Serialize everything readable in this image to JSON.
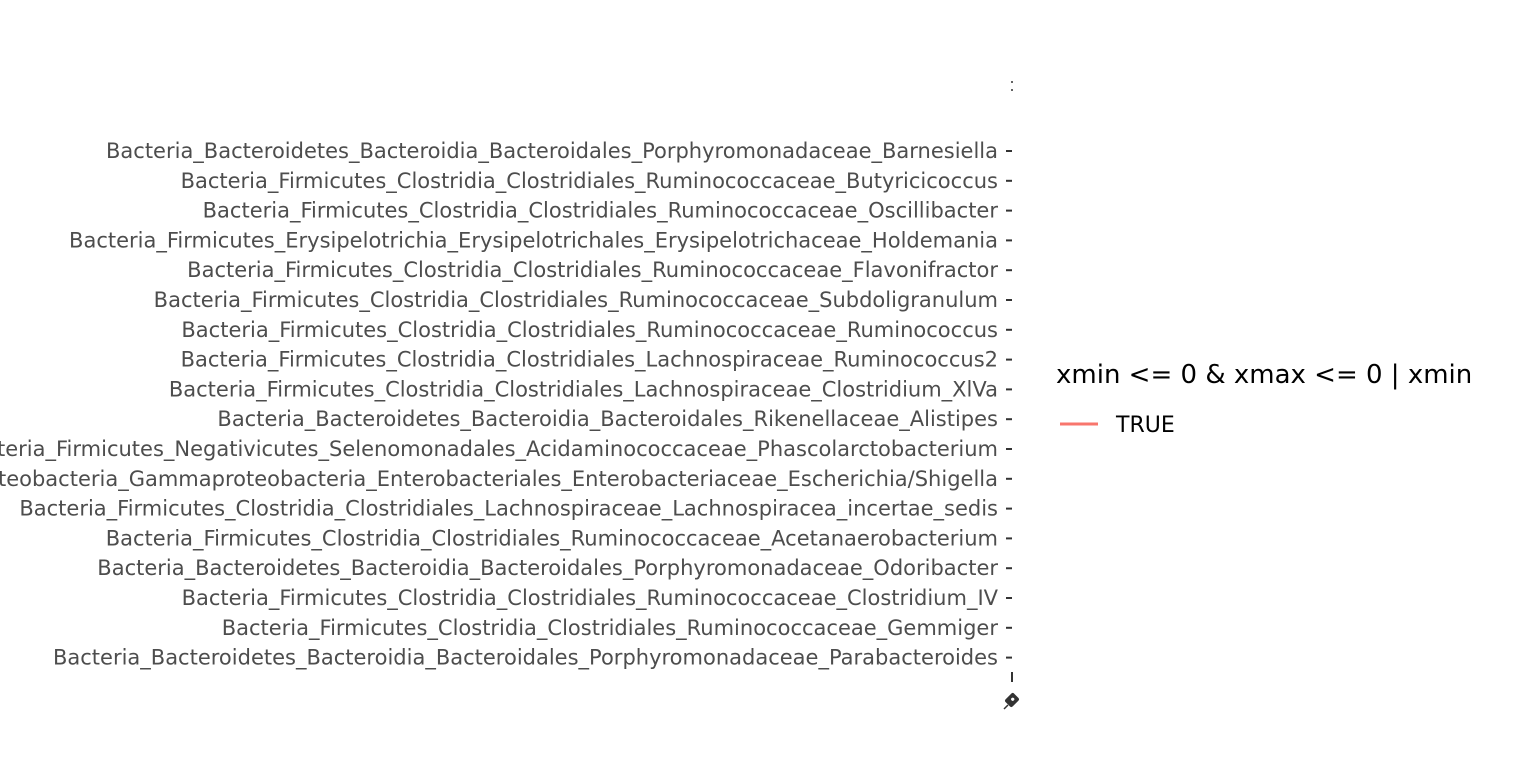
{
  "chart_data": {
    "type": "line",
    "title": "",
    "xlabel": "",
    "ylabel": "",
    "grid": false,
    "legend_position": "right",
    "categories": [
      "Bacteria_Bacteroidetes_Bacteroidia_Bacteroidales_Porphyromonadaceae_Barnesiella",
      "Bacteria_Firmicutes_Clostridia_Clostridiales_Ruminococcaceae_Butyricicoccus",
      "Bacteria_Firmicutes_Clostridia_Clostridiales_Ruminococcaceae_Oscillibacter",
      "Bacteria_Firmicutes_Erysipelotrichia_Erysipelotrichales_Erysipelotrichaceae_Holdemania",
      "Bacteria_Firmicutes_Clostridia_Clostridiales_Ruminococcaceae_Flavonifractor",
      "Bacteria_Firmicutes_Clostridia_Clostridiales_Ruminococcaceae_Subdoligranulum",
      "Bacteria_Firmicutes_Clostridia_Clostridiales_Ruminococcaceae_Ruminococcus",
      "Bacteria_Firmicutes_Clostridia_Clostridiales_Lachnospiraceae_Ruminococcus2",
      "Bacteria_Firmicutes_Clostridia_Clostridiales_Lachnospiraceae_Clostridium_XlVa",
      "Bacteria_Bacteroidetes_Bacteroidia_Bacteroidales_Rikenellaceae_Alistipes",
      "Bacteria_Firmicutes_Negativicutes_Selenomonadales_Acidaminococcaceae_Phascolarctobacterium",
      "Bacteria_Proteobacteria_Gammaproteobacteria_Enterobacteriales_Enterobacteriaceae_Escherichia/Shigella",
      "Bacteria_Firmicutes_Clostridia_Clostridiales_Lachnospiraceae_Lachnospiracea_incertae_sedis",
      "Bacteria_Firmicutes_Clostridia_Clostridiales_Ruminococcaceae_Acetanaerobacterium",
      "Bacteria_Bacteroidetes_Bacteroidia_Bacteroidales_Porphyromonadaceae_Odoribacter",
      "Bacteria_Firmicutes_Clostridia_Clostridiales_Ruminococcaceae_Clostridium_IV",
      "Bacteria_Firmicutes_Clostridia_Clostridiales_Ruminococcaceae_Gemmiger",
      "Bacteria_Bacteroidetes_Bacteroidia_Bacteroidales_Porphyromonadaceae_Parabacteroides"
    ],
    "series": [
      {
        "name": "TRUE",
        "color": "#F8766D"
      }
    ],
    "legend": {
      "title": "xmin <= 0 & xmax <= 0 | xmin",
      "entries": [
        "TRUE"
      ]
    }
  }
}
